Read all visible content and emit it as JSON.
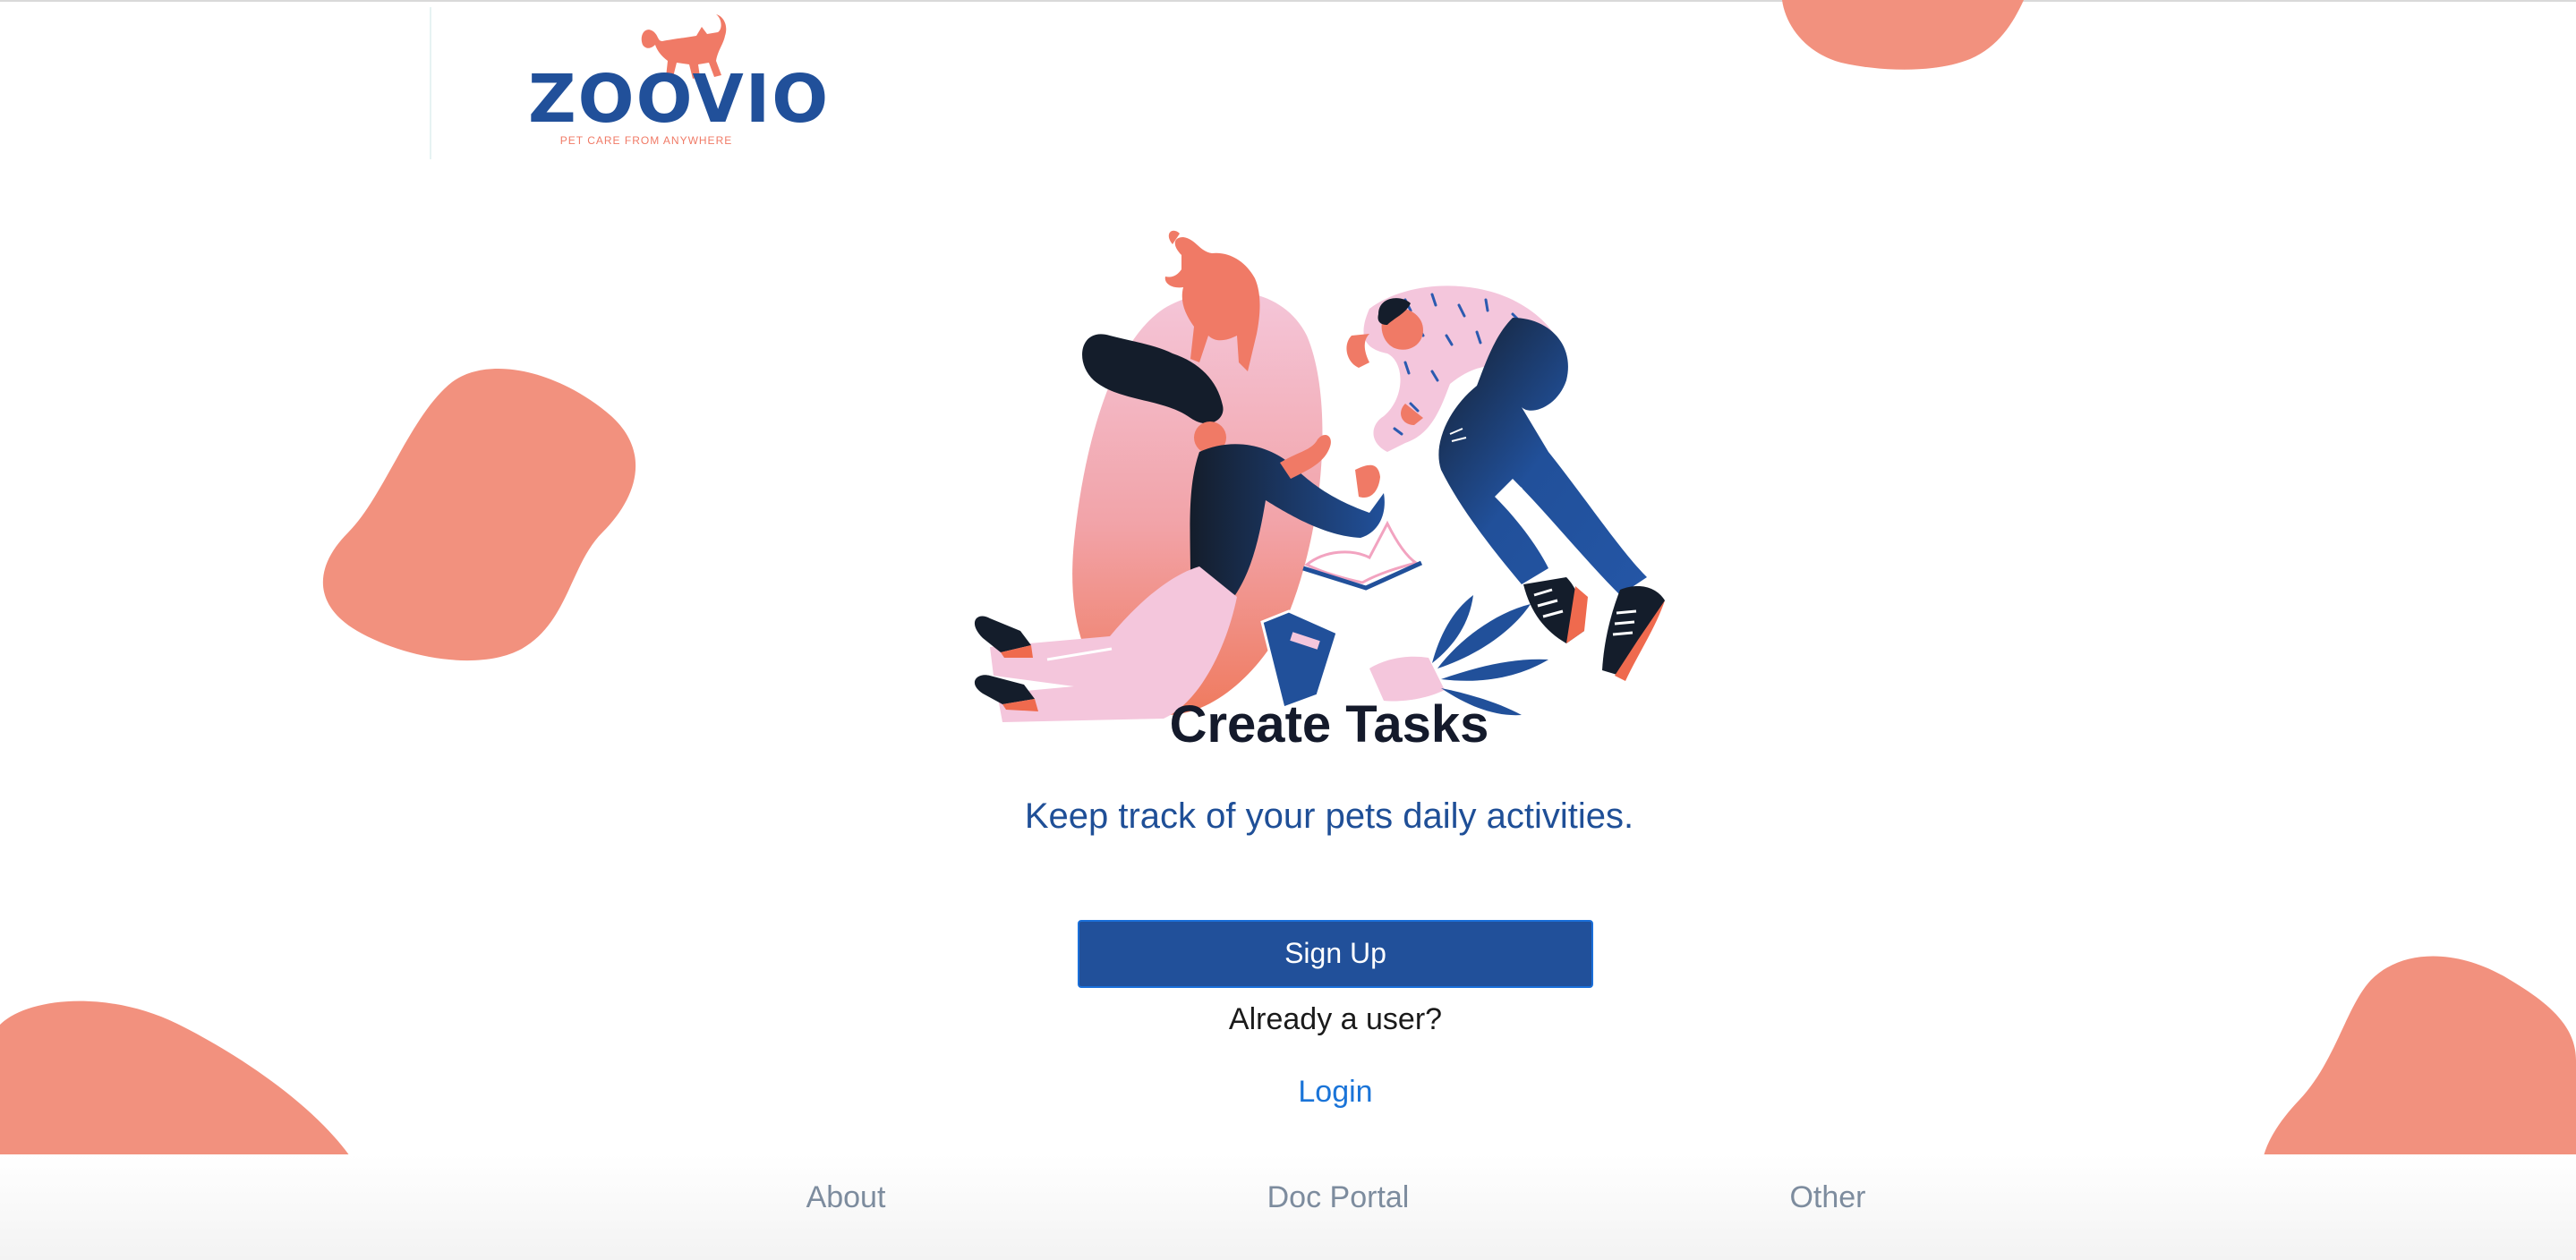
{
  "header": {
    "logo_text": "ZOOVIO",
    "logo_tagline": "PET CARE FROM ANYWHERE",
    "logo_icon": "cat-icon"
  },
  "hero": {
    "illustration": "people-with-cat-illustration",
    "heading": "Create Tasks",
    "subheading": "Keep track of your pets daily activities."
  },
  "actions": {
    "signup_label": "Sign Up",
    "already_user_text": "Already a user?",
    "login_label": "Login"
  },
  "footer": {
    "links": [
      "About",
      "Doc Portal",
      "Other"
    ]
  },
  "colors": {
    "brand_blue": "#21509a",
    "accent_coral": "#f2917e",
    "link_blue": "#1a74d8",
    "heading_dark": "#141a2b",
    "footer_text": "#7d8c9e"
  }
}
